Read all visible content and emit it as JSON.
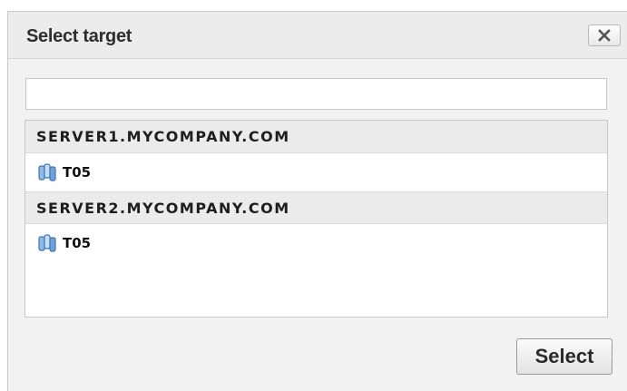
{
  "dialog": {
    "title": "Select target",
    "close_icon": "close-icon"
  },
  "filter": {
    "value": "",
    "placeholder": ""
  },
  "groups": [
    {
      "server": "SERVER1.MYCOMPANY.COM",
      "items": [
        {
          "label": "T05",
          "icon": "server-cluster-icon"
        }
      ]
    },
    {
      "server": "SERVER2.MYCOMPANY.COM",
      "items": [
        {
          "label": "T05",
          "icon": "server-cluster-icon"
        }
      ]
    }
  ],
  "footer": {
    "select_label": "Select"
  },
  "colors": {
    "dialog_bg": "#f2f2f2",
    "header_bg": "#ebebeb",
    "icon_blue": "#4a86c5"
  }
}
